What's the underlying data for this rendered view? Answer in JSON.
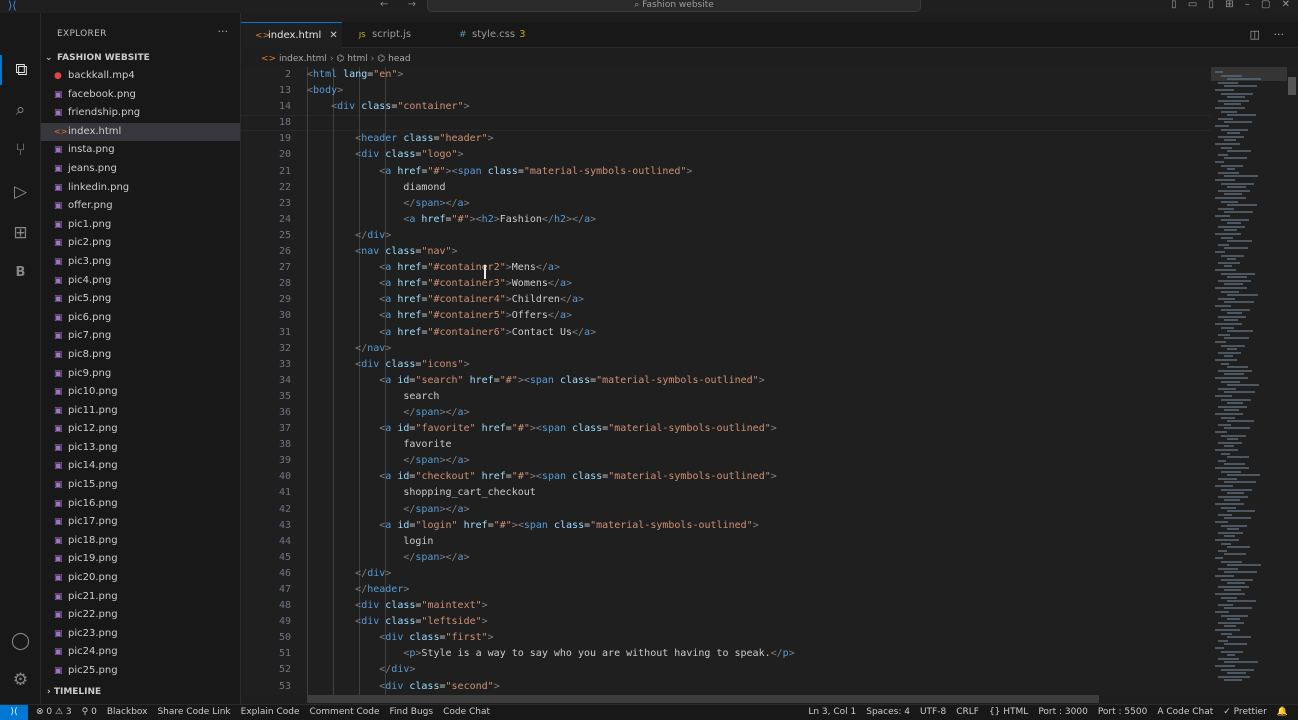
{
  "titlebar": {
    "search": "Fashion website",
    "back": "←",
    "forward": "→"
  },
  "sidebar": {
    "title": "EXPLORER",
    "more": "···",
    "folder": "FASHION WEBSITE",
    "files": [
      {
        "name": "backkall.mp4",
        "type": "mp4"
      },
      {
        "name": "facebook.png",
        "type": "img"
      },
      {
        "name": "friendship.png",
        "type": "img"
      },
      {
        "name": "index.html",
        "type": "html",
        "active": true
      },
      {
        "name": "insta.png",
        "type": "img"
      },
      {
        "name": "jeans.png",
        "type": "img"
      },
      {
        "name": "linkedin.png",
        "type": "img"
      },
      {
        "name": "offer.png",
        "type": "img"
      },
      {
        "name": "pic1.png",
        "type": "img"
      },
      {
        "name": "pic2.png",
        "type": "img"
      },
      {
        "name": "pic3.png",
        "type": "img"
      },
      {
        "name": "pic4.png",
        "type": "img"
      },
      {
        "name": "pic5.png",
        "type": "img"
      },
      {
        "name": "pic6.png",
        "type": "img"
      },
      {
        "name": "pic7.png",
        "type": "img"
      },
      {
        "name": "pic8.png",
        "type": "img"
      },
      {
        "name": "pic9.png",
        "type": "img"
      },
      {
        "name": "pic10.png",
        "type": "img"
      },
      {
        "name": "pic11.png",
        "type": "img"
      },
      {
        "name": "pic12.png",
        "type": "img"
      },
      {
        "name": "pic13.png",
        "type": "img"
      },
      {
        "name": "pic14.png",
        "type": "img"
      },
      {
        "name": "pic15.png",
        "type": "img"
      },
      {
        "name": "pic16.png",
        "type": "img"
      },
      {
        "name": "pic17.png",
        "type": "img"
      },
      {
        "name": "pic18.png",
        "type": "img"
      },
      {
        "name": "pic19.png",
        "type": "img"
      },
      {
        "name": "pic20.png",
        "type": "img"
      },
      {
        "name": "pic21.png",
        "type": "img"
      },
      {
        "name": "pic22.png",
        "type": "img"
      },
      {
        "name": "pic23.png",
        "type": "img"
      },
      {
        "name": "pic24.png",
        "type": "img"
      },
      {
        "name": "pic25.png",
        "type": "img"
      }
    ],
    "timeline": "TIMELINE"
  },
  "tabs": [
    {
      "label": "index.html",
      "icon": "<>",
      "active": true
    },
    {
      "label": "script.js",
      "icon": "JS"
    },
    {
      "label": "style.css",
      "icon": "#",
      "badge": "3"
    }
  ],
  "breadcrumb": [
    "index.html",
    "html",
    "head"
  ],
  "editor": {
    "lines": [
      {
        "n": "2",
        "code": "<html lang=\"en\">"
      },
      {
        "n": "13",
        "code": "<body>"
      },
      {
        "n": "14",
        "code": "    <div class=\"container\">"
      },
      {
        "n": "18",
        "code": ""
      },
      {
        "n": "19",
        "code": "        <header class=\"header\">"
      },
      {
        "n": "20",
        "code": "        <div class=\"logo\">"
      },
      {
        "n": "21",
        "code": "            <a href=\"#\"><span class=\"material-symbols-outlined\">"
      },
      {
        "n": "22",
        "code": "                diamond"
      },
      {
        "n": "23",
        "code": "                </span></a>"
      },
      {
        "n": "24",
        "code": "                <a href=\"#\"><h2>Fashion</h2></a>"
      },
      {
        "n": "25",
        "code": "        </div>"
      },
      {
        "n": "26",
        "code": "        <nav class=\"nav\">"
      },
      {
        "n": "27",
        "code": "            <a href=\"#container2\">Mens</a>"
      },
      {
        "n": "28",
        "code": "            <a href=\"#container3\">Womens</a>"
      },
      {
        "n": "29",
        "code": "            <a href=\"#container4\">Children</a>"
      },
      {
        "n": "30",
        "code": "            <a href=\"#container5\">Offers</a>"
      },
      {
        "n": "31",
        "code": "            <a href=\"#container6\">Contact Us</a>"
      },
      {
        "n": "32",
        "code": "        </nav>"
      },
      {
        "n": "33",
        "code": "        <div class=\"icons\">"
      },
      {
        "n": "34",
        "code": "            <a id=\"search\" href=\"#\"><span class=\"material-symbols-outlined\">"
      },
      {
        "n": "35",
        "code": "                search"
      },
      {
        "n": "36",
        "code": "                </span></a>"
      },
      {
        "n": "37",
        "code": "            <a id=\"favorite\" href=\"#\"><span class=\"material-symbols-outlined\">"
      },
      {
        "n": "38",
        "code": "                favorite"
      },
      {
        "n": "39",
        "code": "                </span></a>"
      },
      {
        "n": "40",
        "code": "            <a id=\"checkout\" href=\"#\"><span class=\"material-symbols-outlined\">"
      },
      {
        "n": "41",
        "code": "                shopping_cart_checkout"
      },
      {
        "n": "42",
        "code": "                </span></a>"
      },
      {
        "n": "43",
        "code": "            <a id=\"login\" href=\"#\"><span class=\"material-symbols-outlined\">"
      },
      {
        "n": "44",
        "code": "                login"
      },
      {
        "n": "45",
        "code": "                </span></a>"
      },
      {
        "n": "46",
        "code": "        </div>"
      },
      {
        "n": "47",
        "code": "        </header>"
      },
      {
        "n": "48",
        "code": "        <div class=\"maintext\">"
      },
      {
        "n": "49",
        "code": "        <div class=\"leftside\">"
      },
      {
        "n": "50",
        "code": "            <div class=\"first\">"
      },
      {
        "n": "51",
        "code": "                <p>Style is a way to say who you are without having to speak.</p>"
      },
      {
        "n": "52",
        "code": "            </div>"
      },
      {
        "n": "53",
        "code": "            <div class=\"second\">"
      }
    ]
  },
  "statusbar": {
    "left": [
      "⊗ 0 ⚠ 3",
      "⚲ 0",
      "Blackbox",
      "Share Code Link",
      "Explain Code",
      "Comment Code",
      "Find Bugs",
      "Code Chat"
    ],
    "right": [
      "Ln 3, Col 1",
      "Spaces: 4",
      "UTF-8",
      "CRLF",
      "{} HTML",
      "Port : 3000",
      "Port : 5500",
      "A Code Chat",
      "✓ Prettier",
      "🔔"
    ]
  },
  "colors": {
    "accent": "#0078d4",
    "tag": "#569cd6",
    "attr": "#9cdcfe",
    "string": "#ce9178",
    "text": "#cccccc"
  }
}
